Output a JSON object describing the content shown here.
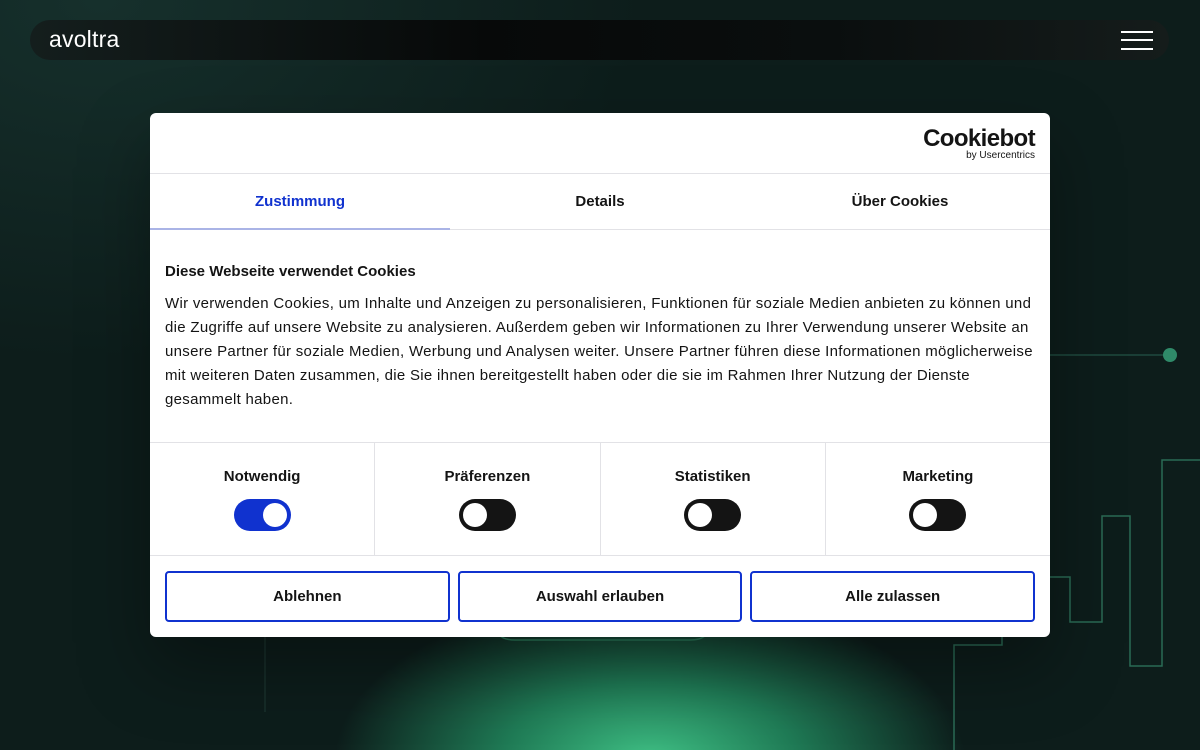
{
  "navbar": {
    "logo": "avoltra"
  },
  "consent": {
    "brand": {
      "name": "Cookiebot",
      "tagline": "by Usercentrics"
    },
    "tabs": [
      {
        "label": "Zustimmung",
        "active": true
      },
      {
        "label": "Details",
        "active": false
      },
      {
        "label": "Über Cookies",
        "active": false
      }
    ],
    "heading": "Diese Webseite verwendet Cookies",
    "body": "Wir verwenden Cookies, um Inhalte und Anzeigen zu personalisieren, Funktionen für soziale Medien anbieten zu können und die Zugriffe auf unsere Website zu analysieren. Außerdem geben wir Informationen zu Ihrer Verwendung unserer Website an unsere Partner für soziale Medien, Werbung und Analysen weiter. Unsere Partner führen diese Informationen möglicherweise mit weiteren Daten zusammen, die Sie ihnen bereitgestellt haben oder die sie im Rahmen Ihrer Nutzung der Dienste gesammelt haben.",
    "categories": [
      {
        "label": "Notwendig",
        "enabled": true
      },
      {
        "label": "Präferenzen",
        "enabled": false
      },
      {
        "label": "Statistiken",
        "enabled": false
      },
      {
        "label": "Marketing",
        "enabled": false
      }
    ],
    "buttons": {
      "decline": "Ablehnen",
      "allow_selection": "Auswahl erlauben",
      "allow_all": "Alle zulassen"
    }
  },
  "colors": {
    "accent": "#1032cf",
    "background": "#0c1716",
    "glow": "#3fbf84",
    "text": "#141414"
  }
}
